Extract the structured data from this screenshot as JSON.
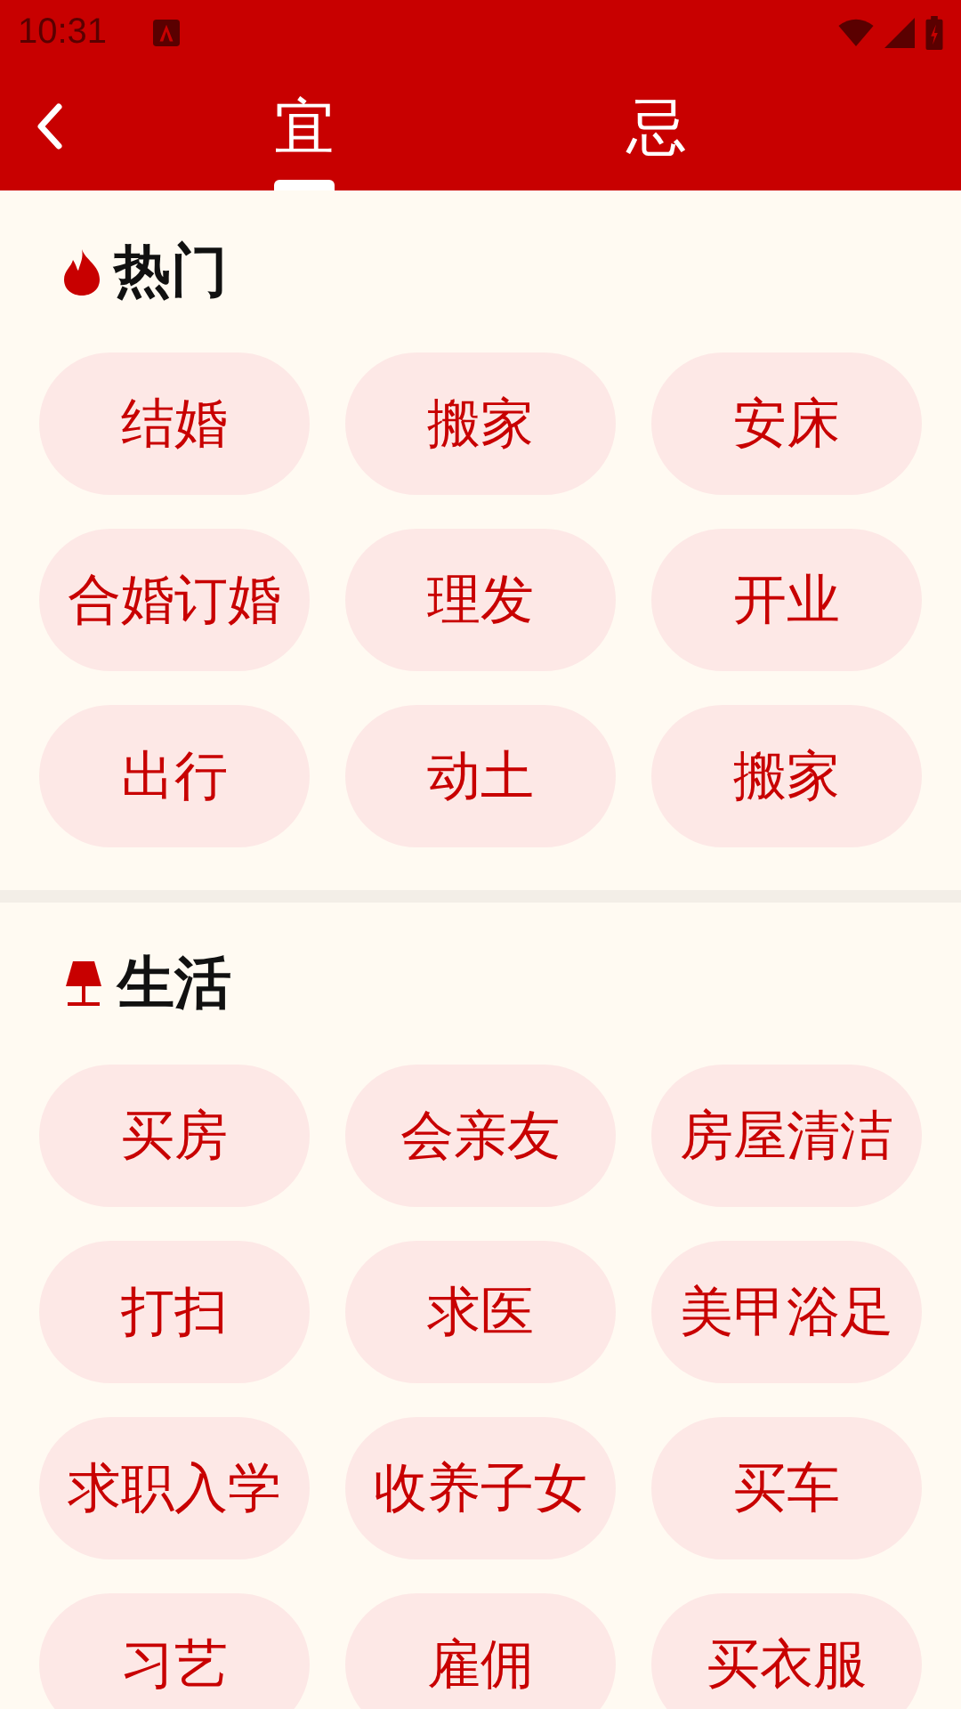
{
  "status_bar": {
    "time": "10:31"
  },
  "tabs": [
    {
      "label": "宜",
      "selected": true
    },
    {
      "label": "忌",
      "selected": false
    }
  ],
  "sections": [
    {
      "title": "热门",
      "kind": "hot",
      "items": [
        "结婚",
        "搬家",
        "安床",
        "合婚订婚",
        "理发",
        "开业",
        "出行",
        "动土",
        "搬家"
      ]
    },
    {
      "title": "生活",
      "kind": "life",
      "items": [
        "买房",
        "会亲友",
        "房屋清洁",
        "打扫",
        "求医",
        "美甲浴足",
        "求职入学",
        "收养子女",
        "买车",
        "习艺",
        "雇佣",
        "买衣服"
      ]
    }
  ]
}
